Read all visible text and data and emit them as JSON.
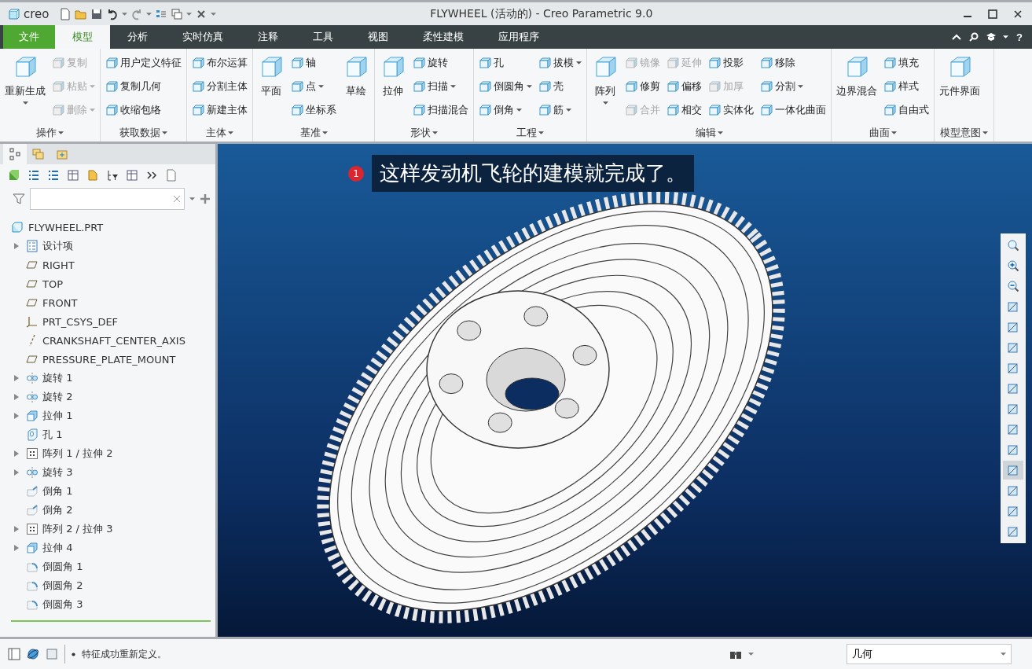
{
  "window": {
    "logo": "creo",
    "title": "FLYWHEEL (活动的) - Creo Parametric 9.0"
  },
  "tabs": [
    {
      "label": "文件",
      "kind": "file",
      "selected": false
    },
    {
      "label": "模型",
      "kind": "tab",
      "selected": true
    },
    {
      "label": "分析",
      "kind": "tab",
      "selected": false
    },
    {
      "label": "实时仿真",
      "kind": "tab",
      "selected": false
    },
    {
      "label": "注释",
      "kind": "tab",
      "selected": false
    },
    {
      "label": "工具",
      "kind": "tab",
      "selected": false
    },
    {
      "label": "视图",
      "kind": "tab",
      "selected": false
    },
    {
      "label": "柔性建模",
      "kind": "tab",
      "selected": false
    },
    {
      "label": "应用程序",
      "kind": "tab",
      "selected": false
    }
  ],
  "help": "?",
  "ribbon": {
    "groups": [
      {
        "label": "操作",
        "columns": [
          {
            "kind": "large",
            "items": [
              {
                "label": "重新生成",
                "dropdown": true,
                "disabled": false
              }
            ]
          },
          {
            "kind": "stack",
            "items": [
              {
                "label": "复制",
                "dropdown": false,
                "disabled": true
              },
              {
                "label": "粘贴",
                "dropdown": true,
                "disabled": true
              },
              {
                "label": "删除",
                "dropdown": true,
                "disabled": true
              }
            ]
          }
        ]
      },
      {
        "label": "获取数据",
        "columns": [
          {
            "kind": "stack",
            "items": [
              {
                "label": "用户定义特征",
                "dropdown": false,
                "disabled": false
              },
              {
                "label": "复制几何",
                "dropdown": false,
                "disabled": false
              },
              {
                "label": "收缩包络",
                "dropdown": false,
                "disabled": false
              }
            ]
          }
        ]
      },
      {
        "label": "主体",
        "columns": [
          {
            "kind": "stack",
            "items": [
              {
                "label": "布尔运算",
                "dropdown": false,
                "disabled": false
              },
              {
                "label": "分割主体",
                "dropdown": false,
                "disabled": false
              },
              {
                "label": "新建主体",
                "dropdown": false,
                "disabled": false
              }
            ]
          }
        ]
      },
      {
        "label": "基准",
        "columns": [
          {
            "kind": "large",
            "items": [
              {
                "label": "平面",
                "dropdown": false,
                "disabled": false
              }
            ]
          },
          {
            "kind": "stack",
            "items": [
              {
                "label": "轴",
                "dropdown": false,
                "disabled": false
              },
              {
                "label": "点",
                "dropdown": true,
                "disabled": false
              },
              {
                "label": "坐标系",
                "dropdown": false,
                "disabled": false
              }
            ]
          },
          {
            "kind": "large",
            "items": [
              {
                "label": "草绘",
                "dropdown": false,
                "disabled": false
              }
            ]
          }
        ]
      },
      {
        "label": "形状",
        "columns": [
          {
            "kind": "large",
            "items": [
              {
                "label": "拉伸",
                "dropdown": false,
                "disabled": false
              }
            ]
          },
          {
            "kind": "stack",
            "items": [
              {
                "label": "旋转",
                "dropdown": false,
                "disabled": false
              },
              {
                "label": "扫描",
                "dropdown": true,
                "disabled": false
              },
              {
                "label": "扫描混合",
                "dropdown": false,
                "disabled": false
              }
            ]
          }
        ]
      },
      {
        "label": "工程",
        "columns": [
          {
            "kind": "stack",
            "items": [
              {
                "label": "孔",
                "dropdown": false,
                "disabled": false
              },
              {
                "label": "倒圆角",
                "dropdown": true,
                "disabled": false
              },
              {
                "label": "倒角",
                "dropdown": true,
                "disabled": false
              }
            ]
          },
          {
            "kind": "stack",
            "items": [
              {
                "label": "拔模",
                "dropdown": true,
                "disabled": false
              },
              {
                "label": "壳",
                "dropdown": false,
                "disabled": false
              },
              {
                "label": "筋",
                "dropdown": true,
                "disabled": false
              }
            ]
          }
        ]
      },
      {
        "label": "编辑",
        "columns": [
          {
            "kind": "large",
            "items": [
              {
                "label": "阵列",
                "dropdown": true,
                "disabled": false
              }
            ]
          },
          {
            "kind": "stack",
            "items": [
              {
                "label": "镜像",
                "dropdown": false,
                "disabled": true
              },
              {
                "label": "修剪",
                "dropdown": false,
                "disabled": false
              },
              {
                "label": "合并",
                "dropdown": false,
                "disabled": true
              }
            ]
          },
          {
            "kind": "stack",
            "items": [
              {
                "label": "延伸",
                "dropdown": false,
                "disabled": true
              },
              {
                "label": "偏移",
                "dropdown": false,
                "disabled": false
              },
              {
                "label": "相交",
                "dropdown": false,
                "disabled": false
              }
            ]
          },
          {
            "kind": "stack",
            "items": [
              {
                "label": "投影",
                "dropdown": false,
                "disabled": false
              },
              {
                "label": "加厚",
                "dropdown": false,
                "disabled": true
              },
              {
                "label": "实体化",
                "dropdown": false,
                "disabled": false
              }
            ]
          },
          {
            "kind": "stack",
            "items": [
              {
                "label": "移除",
                "dropdown": false,
                "disabled": false
              },
              {
                "label": "分割",
                "dropdown": true,
                "disabled": false
              },
              {
                "label": "一体化曲面",
                "dropdown": false,
                "disabled": false
              }
            ]
          }
        ]
      },
      {
        "label": "曲面",
        "columns": [
          {
            "kind": "large",
            "items": [
              {
                "label": "边界混合",
                "dropdown": false,
                "disabled": false
              }
            ]
          },
          {
            "kind": "stack",
            "items": [
              {
                "label": "填充",
                "dropdown": false,
                "disabled": false
              },
              {
                "label": "样式",
                "dropdown": false,
                "disabled": false
              },
              {
                "label": "自由式",
                "dropdown": false,
                "disabled": false
              }
            ]
          }
        ]
      },
      {
        "label": "模型意图",
        "columns": [
          {
            "kind": "large",
            "items": [
              {
                "label": "元件界面",
                "dropdown": false,
                "disabled": false
              }
            ]
          }
        ]
      }
    ]
  },
  "navigator": {
    "tabs": [
      {
        "selected": true
      },
      {
        "selected": false
      },
      {
        "selected": false
      }
    ]
  },
  "tree": {
    "root": "FLYWHEEL.PRT",
    "items": [
      {
        "label": "设计项",
        "kind": "list",
        "expandable": true
      },
      {
        "label": "RIGHT",
        "kind": "plane",
        "expandable": false
      },
      {
        "label": "TOP",
        "kind": "plane",
        "expandable": false
      },
      {
        "label": "FRONT",
        "kind": "plane",
        "expandable": false
      },
      {
        "label": "PRT_CSYS_DEF",
        "kind": "csys",
        "expandable": false
      },
      {
        "label": "CRANKSHAFT_CENTER_AXIS",
        "kind": "axis",
        "expandable": false
      },
      {
        "label": "PRESSURE_PLATE_MOUNT",
        "kind": "plane",
        "expandable": false
      },
      {
        "label": "旋转 1",
        "kind": "revolve",
        "expandable": true
      },
      {
        "label": "旋转 2",
        "kind": "revolve",
        "expandable": true
      },
      {
        "label": "拉伸 1",
        "kind": "extrude",
        "expandable": true
      },
      {
        "label": "孔 1",
        "kind": "hole",
        "expandable": false
      },
      {
        "label": "阵列 1 / 拉伸 2",
        "kind": "pattern",
        "expandable": true
      },
      {
        "label": "旋转 3",
        "kind": "revolve",
        "expandable": true
      },
      {
        "label": "倒角 1",
        "kind": "chamfer",
        "expandable": false
      },
      {
        "label": "倒角 2",
        "kind": "chamfer",
        "expandable": false
      },
      {
        "label": "阵列 2 / 拉伸 3",
        "kind": "pattern",
        "expandable": true
      },
      {
        "label": "拉伸 4",
        "kind": "extrude",
        "expandable": true
      },
      {
        "label": "倒圆角 1",
        "kind": "round",
        "expandable": false
      },
      {
        "label": "倒圆角 2",
        "kind": "round",
        "expandable": false
      },
      {
        "label": "倒圆角 3",
        "kind": "round",
        "expandable": false
      }
    ]
  },
  "viewport": {
    "callout": {
      "number": "1",
      "text": "这样发动机飞轮的建模就完成了。"
    }
  },
  "view_toolbar": [
    {
      "pressed": false
    },
    {
      "pressed": false
    },
    {
      "pressed": false
    },
    {
      "pressed": false
    },
    {
      "pressed": false
    },
    {
      "pressed": false
    },
    {
      "pressed": false
    },
    {
      "pressed": false
    },
    {
      "pressed": false
    },
    {
      "pressed": false
    },
    {
      "pressed": false
    },
    {
      "pressed": true
    },
    {
      "pressed": false
    },
    {
      "pressed": false
    },
    {
      "pressed": false
    }
  ],
  "status_bar": {
    "message": "特征成功重新定义。",
    "filter": "几何"
  }
}
